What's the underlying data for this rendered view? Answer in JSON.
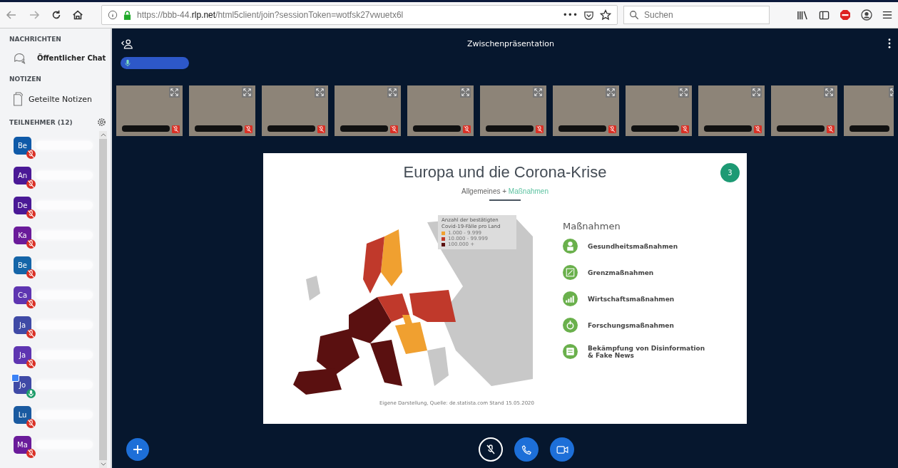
{
  "browser": {
    "url": "https://bbb-44.**rlp.net**/html5client/join?sessionToken=wotfsk27vwuetx6l",
    "more": "•••",
    "search": {
      "placeholder": "Suchen"
    }
  },
  "sidebar": {
    "messages_heading": "NACHRICHTEN",
    "public_chat": "Öffentlicher Chat",
    "notes_heading": "NOTIZEN",
    "shared_notes": "Geteilte Notizen",
    "participants_heading": "TEILNEHMER (12)",
    "participants": [
      {
        "initials": "Be",
        "color": "#0f5aa8",
        "muted": true,
        "presenter": false
      },
      {
        "initials": "An",
        "color": "#4a1996",
        "muted": true,
        "presenter": false
      },
      {
        "initials": "De",
        "color": "#4a1996",
        "muted": true,
        "presenter": false
      },
      {
        "initials": "Ka",
        "color": "#6a1b9a",
        "muted": true,
        "presenter": false
      },
      {
        "initials": "Be",
        "color": "#1565a8",
        "muted": true,
        "presenter": false
      },
      {
        "initials": "Ca",
        "color": "#5e35b1",
        "muted": true,
        "presenter": false
      },
      {
        "initials": "Ja",
        "color": "#3f4aa6",
        "muted": true,
        "presenter": false
      },
      {
        "initials": "Ja",
        "color": "#5e35b1",
        "muted": true,
        "presenter": false
      },
      {
        "initials": "Jo",
        "color": "#3f4aa6",
        "muted": false,
        "presenter": true
      },
      {
        "initials": "Lu",
        "color": "#1a5aa0",
        "muted": true,
        "presenter": false
      },
      {
        "initials": "Ma",
        "color": "#6a1b9a",
        "muted": true,
        "presenter": false
      }
    ]
  },
  "main": {
    "title": "Zwischenpräsentation",
    "videos": [
      {
        "muted": true,
        "clipped": false
      },
      {
        "muted": true,
        "clipped": false
      },
      {
        "muted": true,
        "clipped": false
      },
      {
        "muted": true,
        "clipped": false
      },
      {
        "muted": true,
        "clipped": false
      },
      {
        "muted": true,
        "clipped": false
      },
      {
        "muted": true,
        "clipped": false
      },
      {
        "muted": true,
        "clipped": false
      },
      {
        "muted": true,
        "clipped": false
      },
      {
        "muted": true,
        "clipped": false
      },
      {
        "clipped": true
      }
    ],
    "slide": {
      "title": "Europa und die Corona-Krise",
      "subtitle_part_1": "Allgemeines +",
      "subtitle_part_2": "Maßnahmen",
      "page_number": "3",
      "legend_title": "Anzahl der bestätigten Covid-19-Fälle pro Land",
      "legend": [
        {
          "label": "1.000 - 9.999",
          "color": "#f0a030"
        },
        {
          "label": "10.000 - 99.999",
          "color": "#c0392b"
        },
        {
          "label": "100.000 +",
          "color": "#5a1010"
        }
      ],
      "source": "Eigene Darstellung, Quelle: de.statista.com Stand 15.05.2020",
      "measures_heading": "Maßnahmen",
      "measures": [
        "Gesundheitsmaßnahmen",
        "Grenzmaßnahmen",
        "Wirtschaftsmaßnahmen",
        "Forschungsmaßnahmen",
        "Bekämpfung von Disinformation & Fake News"
      ]
    },
    "controls": {
      "audio_muted": true
    }
  }
}
